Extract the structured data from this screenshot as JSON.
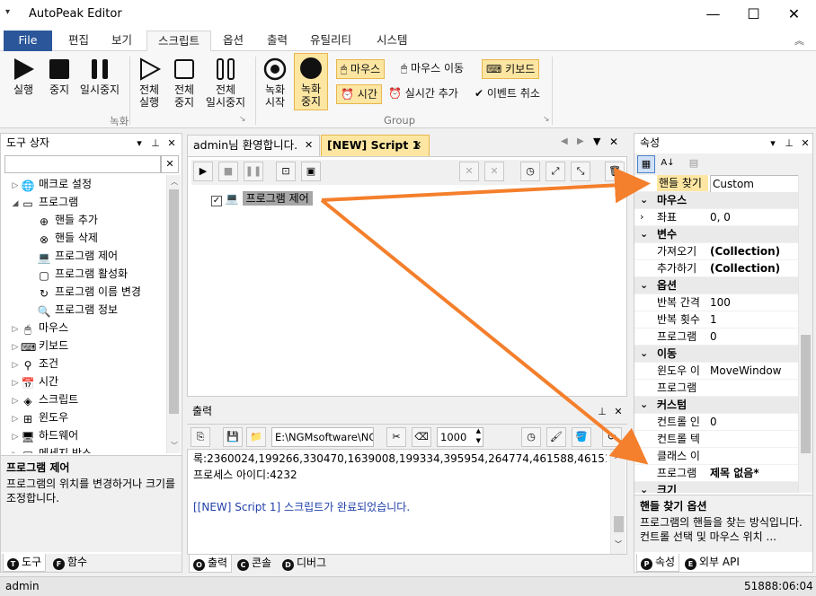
{
  "window": {
    "title": "AutoPeak Editor",
    "minimize": "—",
    "maximize": "☐",
    "close": "✕"
  },
  "ribbon_tabs": [
    "File",
    "편집",
    "보기",
    "스크립트",
    "옵션",
    "출력",
    "유틸리티",
    "시스템"
  ],
  "ribbon": {
    "run": "실행",
    "stop": "중지",
    "pause": "일시중지",
    "all_run_1": "전체",
    "all_run_2": "실행",
    "all_stop_1": "전체",
    "all_stop_2": "중지",
    "all_pause_1": "전체",
    "all_pause_2": "일시중지",
    "group_record": "녹화",
    "rec_start_1": "녹화",
    "rec_start_2": "시작",
    "rec_stop_1": "녹화",
    "rec_stop_2": "중지",
    "mouse": "마우스",
    "mouse_move": "마우스 이동",
    "keyboard": "키보드",
    "time": "시간",
    "realtime_add": "실시간 추가",
    "event_cancel": "이벤트 취소",
    "group_group": "Group"
  },
  "toolbox": {
    "title": "도구 상자",
    "items": [
      {
        "label": "매크로 설정",
        "icon": "globe-icon",
        "level": 0,
        "exp": "▷"
      },
      {
        "label": "프로그램",
        "icon": "program-icon",
        "level": 0,
        "exp": "◢"
      },
      {
        "label": "핸들 추가",
        "icon": "handle-add-icon",
        "level": 1,
        "exp": ""
      },
      {
        "label": "핸들 삭제",
        "icon": "handle-delete-icon",
        "level": 1,
        "exp": ""
      },
      {
        "label": "프로그램 제어",
        "icon": "laptop-icon",
        "level": 1,
        "exp": ""
      },
      {
        "label": "프로그램 활성화",
        "icon": "window-icon",
        "level": 1,
        "exp": ""
      },
      {
        "label": "프로그램 이름 변경",
        "icon": "rename-icon",
        "level": 1,
        "exp": ""
      },
      {
        "label": "프로그램 정보",
        "icon": "search-icon",
        "level": 1,
        "exp": ""
      },
      {
        "label": "마우스",
        "icon": "mouse-icon",
        "level": 0,
        "exp": "▷"
      },
      {
        "label": "키보드",
        "icon": "keyboard-icon",
        "level": 0,
        "exp": "▷"
      },
      {
        "label": "조건",
        "icon": "condition-icon",
        "level": 0,
        "exp": "▷"
      },
      {
        "label": "시간",
        "icon": "calendar-icon",
        "level": 0,
        "exp": "▷"
      },
      {
        "label": "스크립트",
        "icon": "script-icon",
        "level": 0,
        "exp": "▷"
      },
      {
        "label": "윈도우",
        "icon": "windows-icon",
        "level": 0,
        "exp": "▷"
      },
      {
        "label": "하드웨어",
        "icon": "hardware-icon",
        "level": 0,
        "exp": "▷"
      },
      {
        "label": "메세지 박스",
        "icon": "messagebox-icon",
        "level": 0,
        "exp": "▷"
      }
    ],
    "desc_title": "프로그램 제어",
    "desc_text": "프로그램의 위치를 변경하거나 크기를 조정합니다.",
    "tab_tools": "도구",
    "tab_funcs": "함수",
    "tab_tools_letter": "T",
    "tab_funcs_letter": "F"
  },
  "doc": {
    "tab1": "admin님 환영합니다.",
    "tab2": "[NEW] Script 1",
    "script_item": "프로그램 제어"
  },
  "output": {
    "title": "출력",
    "path": "E:\\NGMsoftware\\NG",
    "count": "1000",
    "lines": [
      "록:2360024,199266,330470,1639008,199334,395954,264774,461588,461516",
      "프로세스 아이디:4232",
      "",
      "[[NEW] Script 1] 스크립트가 완료되었습니다."
    ],
    "tab_output": "출력",
    "tab_console": "콘솔",
    "tab_debug": "디버그",
    "tab_output_letter": "O",
    "tab_console_letter": "C",
    "tab_debug_letter": "D"
  },
  "properties": {
    "title": "속성",
    "rows": [
      {
        "kind": "prop",
        "name": "핸들 찾기",
        "value": "Custom",
        "highlight": true,
        "exp": ""
      },
      {
        "kind": "cat",
        "name": "마우스",
        "exp": "⌄"
      },
      {
        "kind": "prop",
        "name": "좌표",
        "value": "0, 0",
        "exp": "›"
      },
      {
        "kind": "cat",
        "name": "변수",
        "exp": "⌄"
      },
      {
        "kind": "prop",
        "name": "가져오기",
        "value": "(Collection)",
        "bold": true,
        "exp": ""
      },
      {
        "kind": "prop",
        "name": "추가하기",
        "value": "(Collection)",
        "bold": true,
        "exp": ""
      },
      {
        "kind": "cat",
        "name": "옵션",
        "exp": "⌄"
      },
      {
        "kind": "prop",
        "name": "반복 간격",
        "value": "100",
        "exp": ""
      },
      {
        "kind": "prop",
        "name": "반복 횟수",
        "value": "1",
        "exp": ""
      },
      {
        "kind": "prop",
        "name": "프로그램",
        "value": "0",
        "exp": ""
      },
      {
        "kind": "cat",
        "name": "이동",
        "exp": "⌄"
      },
      {
        "kind": "prop",
        "name": "윈도우 이",
        "value": "MoveWindow",
        "exp": ""
      },
      {
        "kind": "prop",
        "name": "프로그램",
        "value": "",
        "exp": ""
      },
      {
        "kind": "cat",
        "name": "커스텀",
        "exp": "⌄"
      },
      {
        "kind": "prop",
        "name": "컨트롤 인",
        "value": "0",
        "exp": ""
      },
      {
        "kind": "prop",
        "name": "컨트롤 텍",
        "value": "",
        "exp": ""
      },
      {
        "kind": "prop",
        "name": "클래스 이",
        "value": "",
        "exp": ""
      },
      {
        "kind": "prop",
        "name": "프로그램",
        "value": "제목 없음*",
        "bold": true,
        "exp": ""
      },
      {
        "kind": "cat",
        "name": "크기",
        "exp": "⌄"
      }
    ],
    "desc_title": "핸들 찾기 옵션",
    "desc_text": "프로그램의 핸들을 찾는 방식입니다. 컨트롤 선택 및 마우스 위치 ...",
    "tab_props": "속성",
    "tab_api": "외부 API",
    "tab_props_letter": "P",
    "tab_api_letter": "E"
  },
  "status": {
    "user": "admin",
    "time": "51888:06:04"
  },
  "colors": {
    "accent": "#2b579a",
    "arrow": "#f47f2c",
    "highlight": "#fde6a2"
  }
}
